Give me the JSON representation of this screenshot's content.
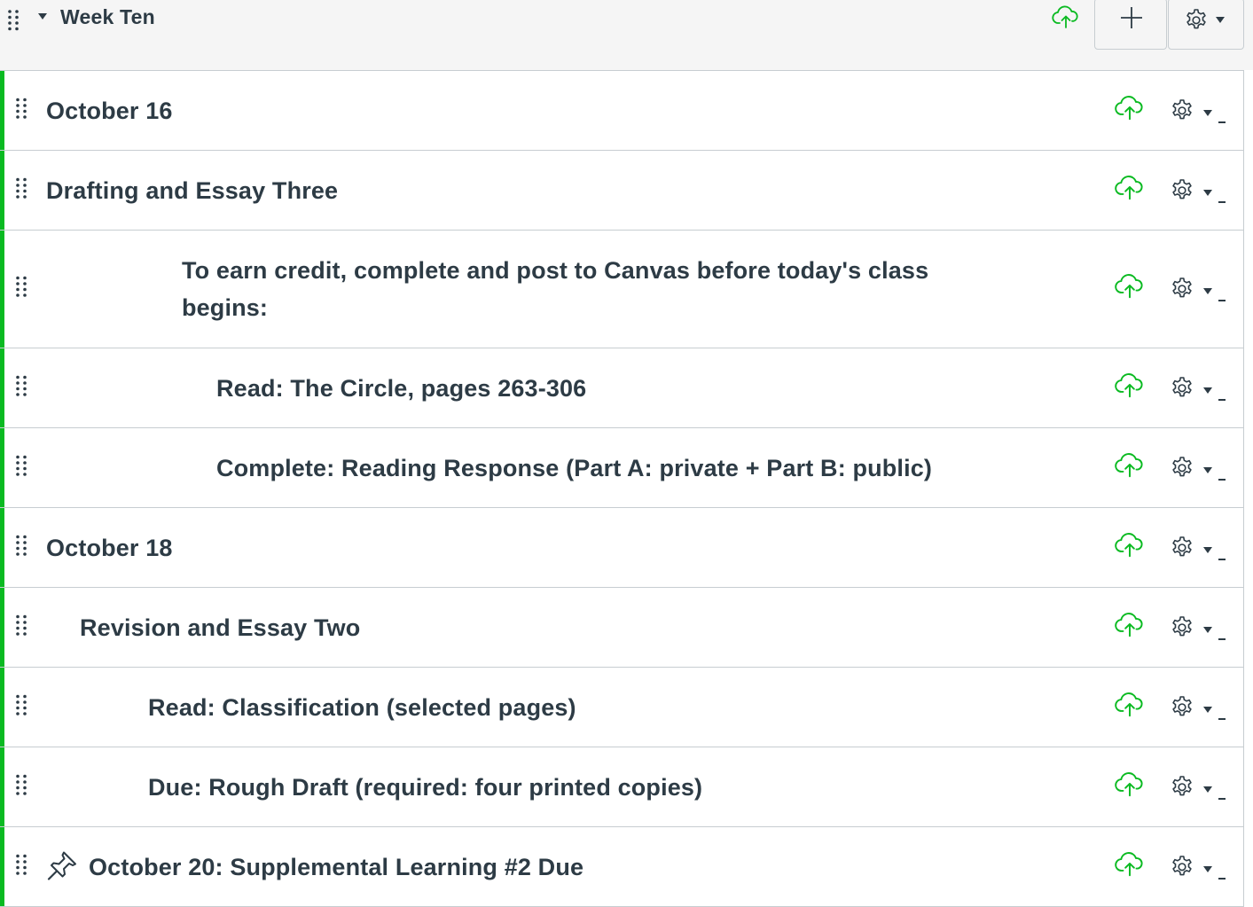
{
  "module": {
    "title": "Week Ten",
    "icons": {
      "drag": "drag-handle-icon",
      "collapse": "caret-down-icon",
      "publish": "cloud-upload-icon",
      "add": "plus-icon",
      "settings": "gear-icon"
    }
  },
  "colors": {
    "published_green": "#0aba21",
    "text": "#2d3b45",
    "border": "#c7cdd1",
    "header_bg": "#f5f5f5"
  },
  "items": [
    {
      "label": "October 16",
      "indent": 0,
      "pinned": false
    },
    {
      "label": "Drafting and Essay Three",
      "indent": 0,
      "pinned": false
    },
    {
      "label": "To earn credit, complete and post to Canvas before today's class begins:",
      "indent": 3,
      "pinned": false
    },
    {
      "label": "Read: The Circle, pages 263-306",
      "indent": 4,
      "pinned": false
    },
    {
      "label": "Complete: Reading Response (Part A: private + Part B: public)",
      "indent": 4,
      "pinned": false
    },
    {
      "label": "October 18",
      "indent": 0,
      "pinned": false
    },
    {
      "label": "Revision and Essay Two",
      "indent": 1,
      "pinned": false
    },
    {
      "label": "Read: Classification (selected pages)",
      "indent": 2,
      "pinned": false
    },
    {
      "label": "Due: Rough Draft (required: four printed copies)",
      "indent": 2,
      "pinned": false
    },
    {
      "label": "October 20: Supplemental Learning #2 Due",
      "indent": 0,
      "pinned": true
    }
  ]
}
